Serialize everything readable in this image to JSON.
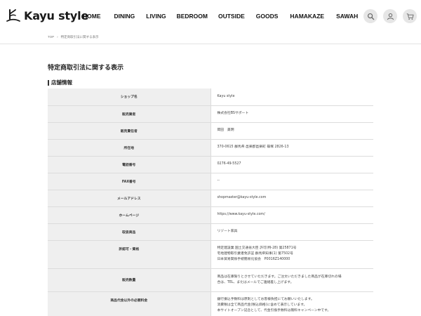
{
  "brand": {
    "name": "Kayu style"
  },
  "nav": [
    "HOME",
    "DINING",
    "LIVING",
    "BEDROOM",
    "OUTSIDE",
    "GOODS",
    "HAMAKAZE",
    "SAWAH"
  ],
  "breadcrumb": [
    "TOP",
    "›",
    "特定商取引法に関する表示"
  ],
  "page_title": "特定商取引法に関する表示",
  "section_title": "店舗情報",
  "rows": [
    {
      "label": "ショップ名",
      "lines": [
        "Kayu style"
      ]
    },
    {
      "label": "販売業者",
      "lines": [
        "株式会社BSサポート"
      ]
    },
    {
      "label": "販売責任者",
      "lines": [
        "岡田　美明"
      ]
    },
    {
      "label": "所在地",
      "lines": [
        "370-0615 群馬県 邑楽郡邑楽町 篠塚 2826-13"
      ]
    },
    {
      "label": "電話番号",
      "lines": [
        "0276-49-5527"
      ]
    },
    {
      "label": "FAX番号",
      "lines": [
        "--"
      ]
    },
    {
      "label": "メールアドレス",
      "lines": [
        "shopmaster@kayu-style.com"
      ]
    },
    {
      "label": "ホームページ",
      "lines": [
        "https://www.kayu-style.com/"
      ]
    },
    {
      "label": "取扱商品",
      "lines": [
        "リゾート家具"
      ]
    },
    {
      "label": "許認可・資格",
      "lines": [
        "特定建設業 国土交通省大臣 許可(特-28) 第25871号",
        "宅地建物取引業者免許証 群馬県知事(1) 第7502号",
        "日本貿易関係手続簡易化協会　P0016Z140000"
      ]
    },
    {
      "label": "販売数量",
      "lines": [
        "商品は在庫限りとさせていただきます。ご注文いただきました商品が在庫切れの場",
        "合は、TEL、またはメールでご連絡差し上げます。"
      ]
    },
    {
      "label": "商品代金以外の必要料金",
      "lines": [
        "銀行振込手数料は原則としてお客様負担にてお願いいたします。",
        "消費税は全て商品代金(税込価格)に含めて表示しています。",
        "本サイトオープン記念として、代金引換手数料は無料キャンペーン中です。"
      ]
    }
  ],
  "colors": {
    "label_bg": "#efefef",
    "border": "#dcdcdc",
    "icon_bg": "#e6e6e6"
  },
  "icons": [
    "search-icon",
    "user-icon",
    "cart-icon"
  ]
}
